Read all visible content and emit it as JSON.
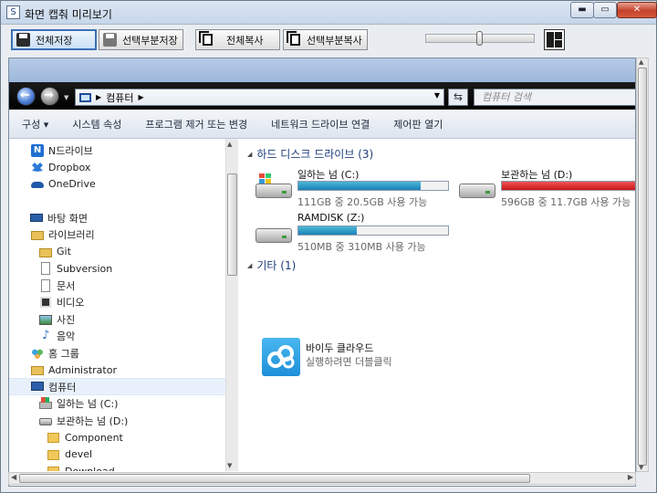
{
  "window": {
    "title": "화면 캡춰 미리보기",
    "app_icon": "S",
    "controls": {
      "minimize": "▬",
      "maximize": "▭",
      "close": "✕"
    }
  },
  "toolbar": {
    "save_all": "전체저장",
    "save_part": "선택부분저장",
    "copy_all": "전체복사",
    "copy_part": "선택부분복사",
    "zoom_level": 0.5
  },
  "explorer": {
    "address": {
      "path": "컴퓨터",
      "search_placeholder": "컴퓨터 검색"
    },
    "commands": [
      "구성 ▾",
      "시스템 속성",
      "프로그램 제거 또는 변경",
      "네트워크 드라이브 연결",
      "제어판 열기"
    ],
    "nav": [
      {
        "label": "N드라이브",
        "icon": "ndrive-icon",
        "indent": 1
      },
      {
        "label": "Dropbox",
        "icon": "dropbox-icon",
        "indent": 1
      },
      {
        "label": "OneDrive",
        "icon": "onedrive-icon",
        "indent": 1
      },
      {
        "label": "",
        "icon": "",
        "indent": 0
      },
      {
        "label": "바탕 화면",
        "icon": "desktop-icon",
        "indent": 0
      },
      {
        "label": "라이브러리",
        "icon": "library-icon",
        "indent": 1
      },
      {
        "label": "Git",
        "icon": "library-icon",
        "indent": 2
      },
      {
        "label": "Subversion",
        "icon": "document-icon",
        "indent": 2
      },
      {
        "label": "문서",
        "icon": "document-icon",
        "indent": 2
      },
      {
        "label": "비디오",
        "icon": "video-icon",
        "indent": 2
      },
      {
        "label": "사진",
        "icon": "picture-icon",
        "indent": 2
      },
      {
        "label": "음악",
        "icon": "music-icon",
        "indent": 2
      },
      {
        "label": "홈 그룹",
        "icon": "homegroup-icon",
        "indent": 1
      },
      {
        "label": "Administrator",
        "icon": "user-folder-icon",
        "indent": 1
      },
      {
        "label": "컴퓨터",
        "icon": "computer-icon",
        "indent": 1,
        "selected": true
      },
      {
        "label": "일하는 넘 (C:)",
        "icon": "windows-drive-icon",
        "indent": 2
      },
      {
        "label": "보관하는 넘 (D:)",
        "icon": "hard-drive-icon",
        "indent": 2
      },
      {
        "label": "Component",
        "icon": "folder-icon",
        "indent": 3
      },
      {
        "label": "devel",
        "icon": "folder-icon",
        "indent": 3
      },
      {
        "label": "Download",
        "icon": "folder-icon",
        "indent": 3
      }
    ],
    "groups": {
      "hdd": "하드 디스크 드라이브 (3)",
      "other": "기타 (1)"
    },
    "drives": [
      {
        "name": "일하는 넘 (C:)",
        "info": "111GB 중 20.5GB 사용 가능",
        "used": 0.82,
        "color": "#1a82b8",
        "windows": true
      },
      {
        "name": "보관하는 넘 (D:)",
        "info": "596GB 중 11.7GB 사용 가능",
        "used": 0.98,
        "color": "#c91818",
        "windows": false
      },
      {
        "name": "RAMDISK (Z:)",
        "info": "510MB 중 310MB 사용 가능",
        "used": 0.39,
        "color": "#1a82b8",
        "windows": false
      }
    ],
    "other_item": {
      "name": "바이두 클라우드",
      "sub": "실행하려면 더블클릭"
    }
  }
}
